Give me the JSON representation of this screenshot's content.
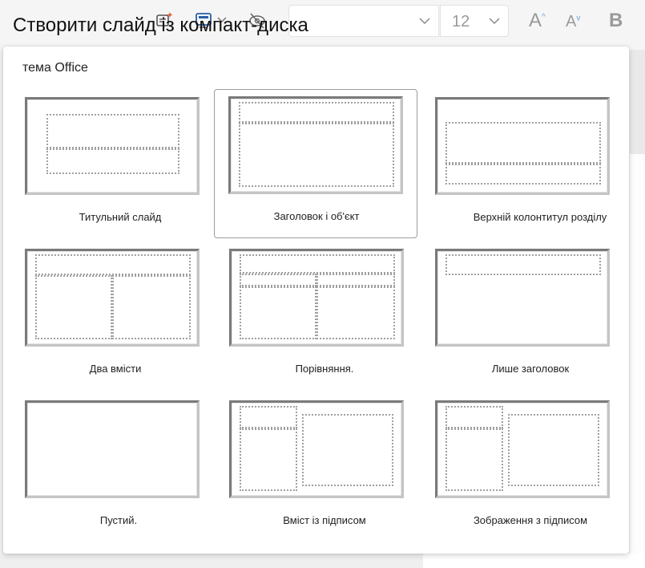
{
  "dialog": {
    "title": "Створити слайд із компакт-диска",
    "section_label": "тема Office"
  },
  "ribbon": {
    "font_size_value": "12",
    "icons": [
      "designer-icon",
      "slide-layout-icon",
      "chevron-down-icon",
      "hide-slide-icon",
      "chevron-down-icon",
      "grow-font-icon",
      "shrink-font-icon",
      "bold-icon"
    ],
    "grow_glyph": "A",
    "shrink_glyph": "A",
    "bold_glyph": "B"
  },
  "layouts": [
    {
      "label": "Титульний слайд",
      "selected": false
    },
    {
      "label": "Заголовок і об'єкт",
      "selected": true
    },
    {
      "label": "Верхній колонтитул розділу",
      "selected": false
    },
    {
      "label": "Два вмісти",
      "selected": false
    },
    {
      "label": "Порівняння.",
      "selected": false
    },
    {
      "label": "Лише заголовок",
      "selected": false
    },
    {
      "label": "Пустий.",
      "selected": false
    },
    {
      "label": "Вміст із підписом",
      "selected": false
    },
    {
      "label": "Зображення з підписом",
      "selected": false
    }
  ],
  "colors": {
    "selection_border": "#9d9d9d",
    "placeholder_dots": "#a0a0a0",
    "accent_caret": "#6fa3d8"
  }
}
